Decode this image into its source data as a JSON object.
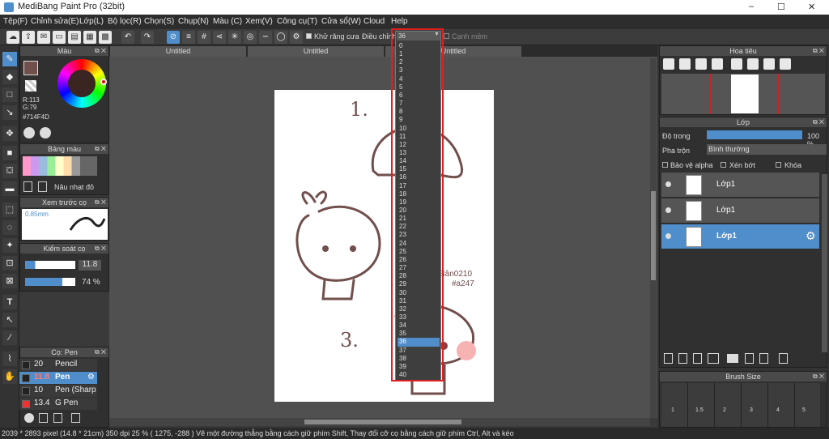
{
  "window": {
    "title": "MediBang Paint Pro (32bit)",
    "controls": [
      "–",
      "☐",
      "✕"
    ]
  },
  "menu": [
    "Tệp(F)",
    "Chỉnh sửa(E)",
    "Lớp(L)",
    "Bộ lọc(R)",
    "Chọn(S)",
    "Chụp(N)",
    "Màu (C)",
    "Xem(V)",
    "Công cụ(T)",
    "Cửa sổ(W)",
    "Cloud",
    "Help"
  ],
  "toolbar": {
    "antialias_label": "Khử răng cưa",
    "adjust_label": "Điều chỉnh",
    "adjust_value": "36",
    "edge_label": "Cạnh mềm"
  },
  "tabs": [
    "Untitled",
    "Untitled",
    "Untitled"
  ],
  "dropdown": {
    "options": [
      "0",
      "1",
      "2",
      "3",
      "4",
      "5",
      "6",
      "7",
      "8",
      "9",
      "10",
      "11",
      "12",
      "13",
      "14",
      "15",
      "16",
      "17",
      "18",
      "19",
      "20",
      "21",
      "22",
      "23",
      "24",
      "25",
      "26",
      "27",
      "28",
      "29",
      "30",
      "31",
      "32",
      "33",
      "34",
      "35",
      "36",
      "37",
      "38",
      "39",
      "40"
    ],
    "selected": "36"
  },
  "color_panel": {
    "title": "Màu",
    "r": "R:113",
    "g": "G:79",
    "hex": "#714F4D",
    "color": "#714f4d"
  },
  "palette": {
    "title": "Bảng màu",
    "item_label": "Nâu nhạt đỏ"
  },
  "brush_preview": {
    "title": "Xem trước cọ",
    "size": "0.85mm"
  },
  "brush_control": {
    "title": "Kiểm soát cọ",
    "size": "11.8",
    "opacity": "74 %"
  },
  "brush_list": {
    "title": "Cọ: Pen",
    "items": [
      {
        "size": "20",
        "name": "Pencil",
        "swatch": "#222"
      },
      {
        "size": "11.8",
        "name": "Pen",
        "swatch": "#222"
      },
      {
        "size": "10",
        "name": "Pen (Sharp",
        "swatch": "#222"
      },
      {
        "size": "13.4",
        "name": "G Pen",
        "swatch": "#e33"
      }
    ]
  },
  "navigator": {
    "title": "Hoa tiêu"
  },
  "layers": {
    "title": "Lớp",
    "opacity_label": "Độ trong",
    "opacity_value": "100 %",
    "blend_label": "Pha trộn",
    "blend_value": "Bình thường",
    "protect_alpha": "Bảo vệ alpha",
    "clip": "Xén bớt",
    "lock": "Khóa",
    "items": [
      "Lớp1",
      "Lớp1",
      "Lớp1"
    ]
  },
  "brush_size": {
    "title": "Brush Size",
    "labels": [
      "1",
      "1.5",
      "2",
      "3",
      "4",
      "5"
    ]
  },
  "canvas_text": {
    "num1": "1.",
    "num3": "3.",
    "sig1": "Bân0210",
    "sig2": "#a247"
  },
  "status": "2039 * 2893 pixel   (14.8 * 21cm)   350 dpi   25 %   ( 1275, -288 )   Vẽ một đường thẳng bằng cách giữ phím Shift, Thay đổi cỡ cọ bằng cách giữ phím Ctrl, Alt và kéo"
}
